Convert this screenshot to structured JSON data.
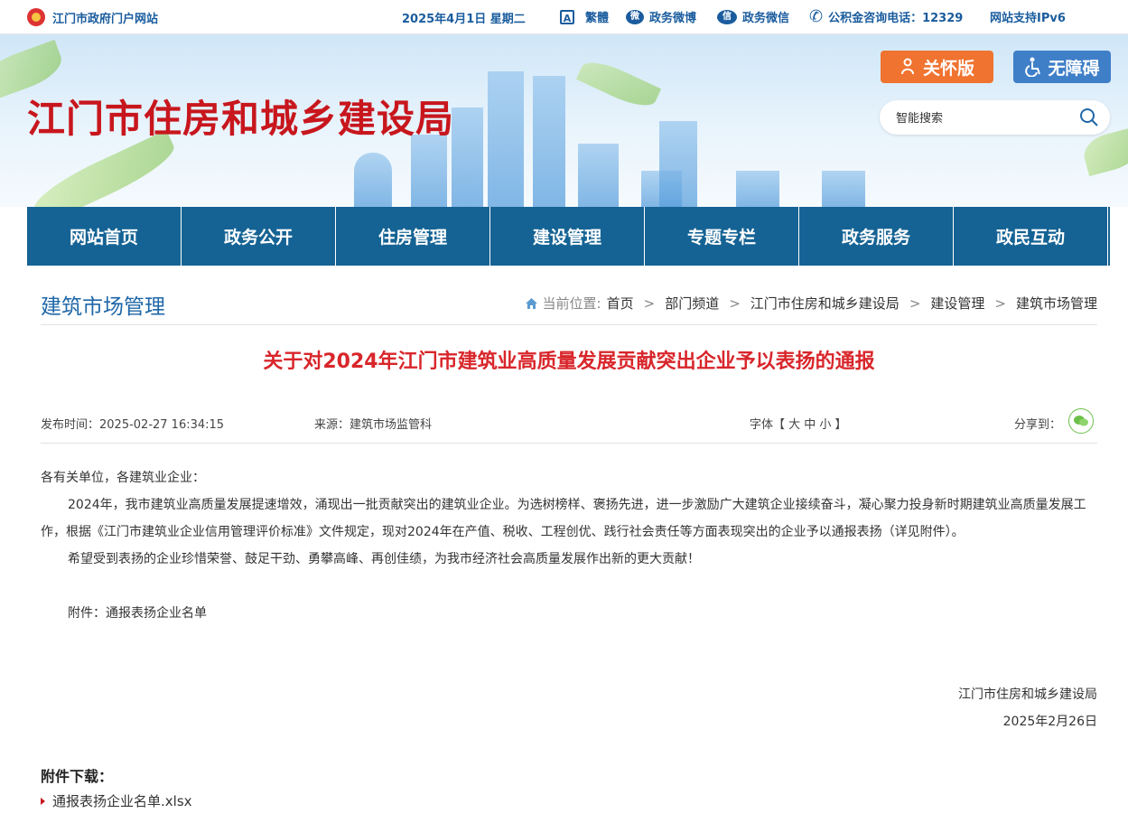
{
  "topbar": {
    "portal": "江门市政府门户网站",
    "date": "2025年4月1日 星期二",
    "traditional": "繁體",
    "weibo": "政务微博",
    "wechat": "政务微信",
    "hotline": "公积金咨询电话：12329",
    "ipv6": "网站支持IPv6"
  },
  "banner": {
    "title": "江门市住房和城乡建设局",
    "care_button": "关怀版",
    "accessible_button": "无障碍",
    "search_placeholder": "智能搜索"
  },
  "nav": [
    "网站首页",
    "政务公开",
    "住房管理",
    "建设管理",
    "专题专栏",
    "政务服务",
    "政民互动"
  ],
  "section_title": "建筑市场管理",
  "breadcrumb": {
    "label": "当前位置:",
    "items": [
      "首页",
      "部门频道",
      "江门市住房和城乡建设局",
      "建设管理",
      "建筑市场管理"
    ],
    "sep": ">"
  },
  "article": {
    "title": "关于对2024年江门市建筑业高质量发展贡献突出企业予以表扬的通报",
    "publish_time": "发布时间：2025-02-27 16:34:15",
    "source": "来源：建筑市场监管科",
    "font_size": "字体【 大  中  小 】",
    "share": "分享到：",
    "salutation": "各有关单位，各建筑业企业：",
    "para1": "2024年，我市建筑业高质量发展提速增效，涌现出一批贡献突出的建筑业企业。为选树榜样、褒扬先进，进一步激励广大建筑企业接续奋斗，凝心聚力投身新时期建筑业高质量发展工作，根据《江门市建筑业企业信用管理评价标准》文件规定，现对2024年在产值、税收、工程创优、践行社会责任等方面表现突出的企业予以通报表扬（详见附件）。",
    "para2": "希望受到表扬的企业珍惜荣誉、鼓足干劲、勇攀高峰、再创佳绩，为我市经济社会高质量发展作出新的更大贡献！",
    "attachment_note": "附件：通报表扬企业名单",
    "signer": "江门市住房和城乡建设局",
    "sign_date": "2025年2月26日"
  },
  "attachments": {
    "heading": "附件下载：",
    "files": [
      "通报表扬企业名单.xlsx"
    ]
  },
  "colors": {
    "brand_red": "#c8161d",
    "nav_blue": "#156394",
    "care_orange": "#f07330",
    "access_blue": "#3f7fc8"
  }
}
